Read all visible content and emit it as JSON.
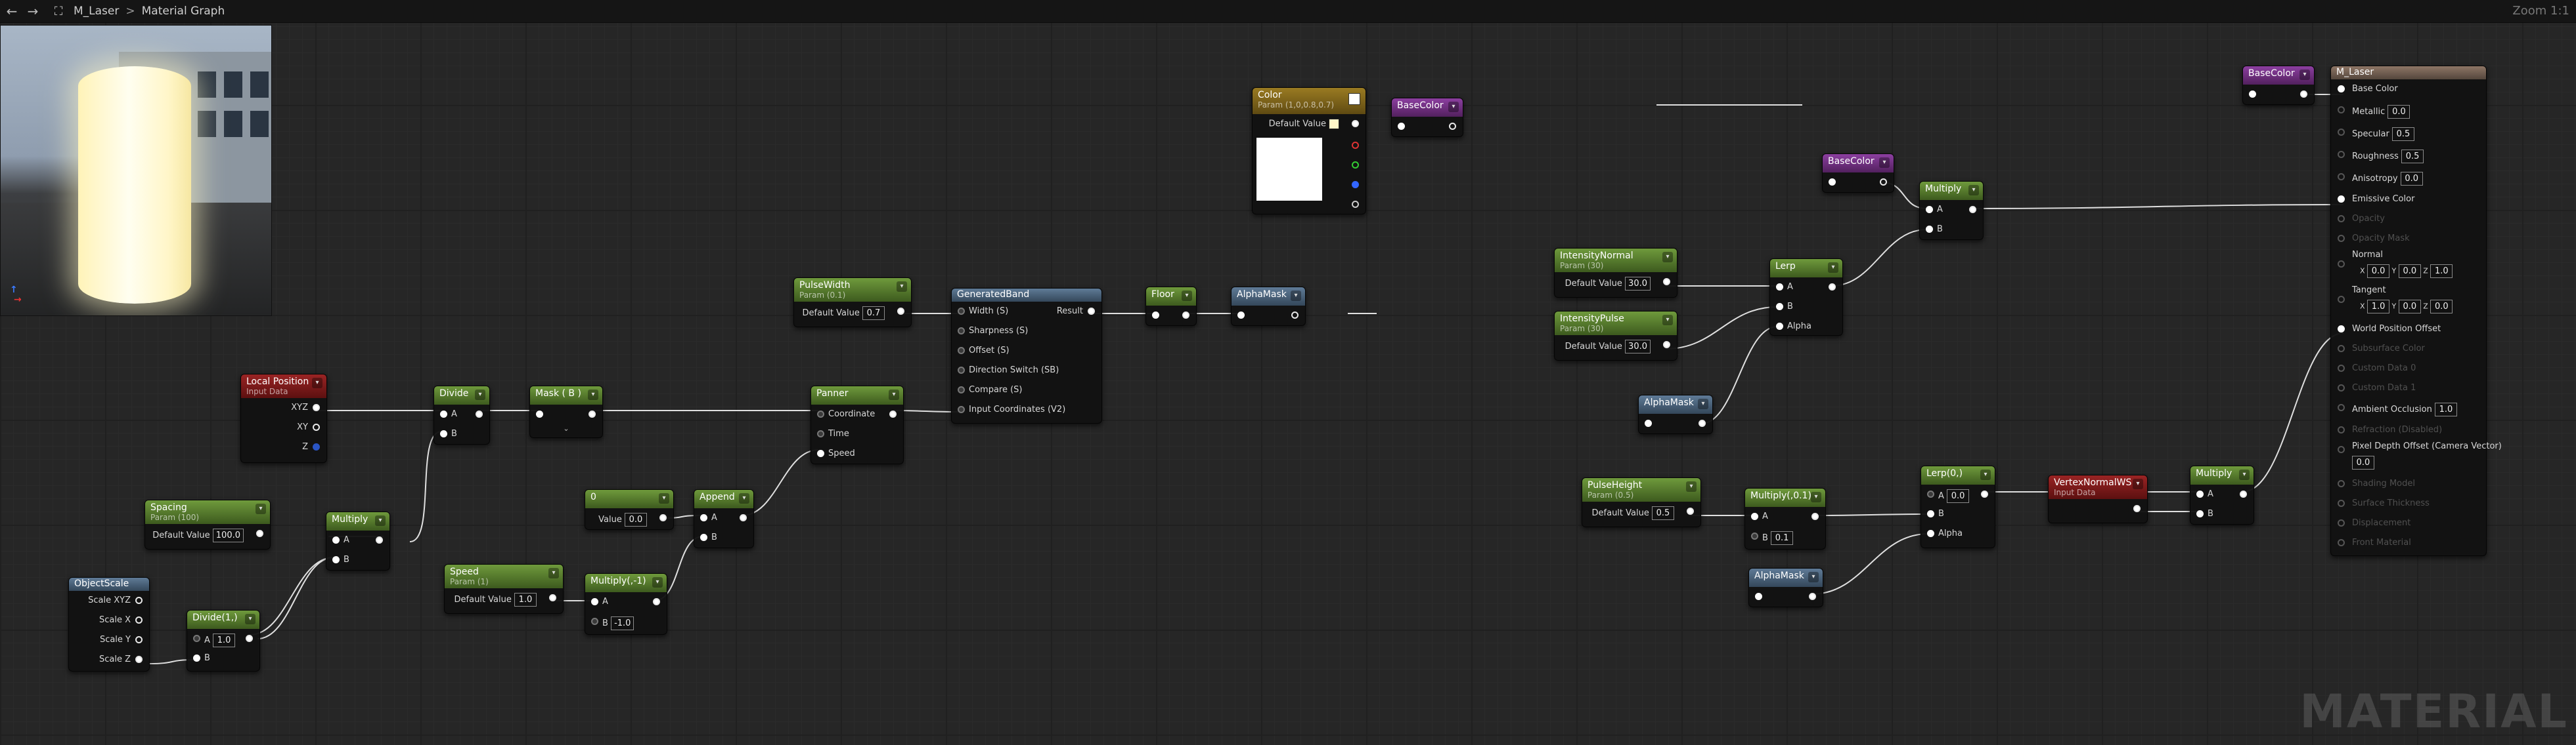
{
  "topbar": {
    "back_icon": "←",
    "forward_icon": "→",
    "graph_icon": "⛶",
    "asset": "M_Laser",
    "separator": ">",
    "title": "Material Graph",
    "zoom": "Zoom 1:1"
  },
  "watermark": "MATERIAL",
  "nodes": {
    "color": {
      "title": "Color",
      "subtitle": "Param (1,0,0.8,0.7)",
      "default_label": "Default Value"
    },
    "basecolor_1": {
      "title": "BaseColor"
    },
    "pulsewidth": {
      "title": "PulseWidth",
      "subtitle": "Param (0.1)",
      "default_label": "Default Value",
      "value": "0.7"
    },
    "generatedband": {
      "title": "GeneratedBand",
      "pins": [
        "Width (S)",
        "Sharpness (S)",
        "Offset (S)",
        "Direction Switch (SB)",
        "Compare (S)",
        "Input Coordinates (V2)"
      ],
      "result": "Result"
    },
    "floor": {
      "title": "Floor"
    },
    "alphamask_1": {
      "title": "AlphaMask"
    },
    "local_position": {
      "title": "Local Position",
      "subtitle": "Input Data",
      "pins": [
        "XYZ",
        "XY",
        "Z"
      ]
    },
    "divide": {
      "title": "Divide",
      "a": "A",
      "b": "B"
    },
    "mask": {
      "title": "Mask ( B )"
    },
    "panner": {
      "title": "Panner",
      "pins": [
        "Coordinate",
        "Time",
        "Speed"
      ]
    },
    "spacing": {
      "title": "Spacing",
      "subtitle": "Param (100)",
      "default_label": "Default Value",
      "value": "100.0"
    },
    "multiply_1": {
      "title": "Multiply",
      "a": "A",
      "b": "B"
    },
    "objectscale": {
      "title": "ObjectScale",
      "pins": [
        "Scale XYZ",
        "Scale X",
        "Scale Y",
        "Scale Z"
      ]
    },
    "divide2": {
      "title": "Divide(1,)",
      "a": "A",
      "a_value": "1.0",
      "b": "B"
    },
    "speed": {
      "title": "Speed",
      "subtitle": "Param (1)",
      "default_label": "Default Value",
      "value": "1.0"
    },
    "multiply_neg": {
      "title": "Multiply(,-1)",
      "a": "A",
      "b": "B",
      "b_value": "-1.0"
    },
    "constant": {
      "title": "0",
      "value_label": "Value",
      "value": "0.0"
    },
    "append": {
      "title": "Append",
      "a": "A",
      "b": "B"
    },
    "basecolor_2": {
      "title": "BaseColor"
    },
    "multiply_2": {
      "title": "Multiply",
      "a": "A",
      "b": "B"
    },
    "intensity_normal": {
      "title": "IntensityNormal",
      "subtitle": "Param (30)",
      "default_label": "Default Value",
      "value": "30.0"
    },
    "intensity_pulse": {
      "title": "IntensityPulse",
      "subtitle": "Param (30)",
      "default_label": "Default Value",
      "value": "30.0"
    },
    "lerp_1": {
      "title": "Lerp",
      "pins": [
        "A",
        "B",
        "Alpha"
      ]
    },
    "alphamask_2": {
      "title": "AlphaMask"
    },
    "pulseheight": {
      "title": "PulseHeight",
      "subtitle": "Param (0.5)",
      "default_label": "Default Value",
      "value": "0.5"
    },
    "multiply_01": {
      "title": "Multiply(,0.1)",
      "a": "A",
      "b": "B",
      "b_value": "0.1"
    },
    "alphamask_3": {
      "title": "AlphaMask"
    },
    "lerp_2": {
      "title": "Lerp(0,)",
      "a": "A",
      "a_value": "0.0",
      "b": "B",
      "alpha": "Alpha"
    },
    "vertexnormal": {
      "title": "VertexNormalWS",
      "subtitle": "Input Data"
    },
    "multiply_3": {
      "title": "Multiply",
      "a": "A",
      "b": "B"
    },
    "basecolor_3": {
      "title": "BaseColor"
    },
    "result": {
      "title": "M_Laser",
      "base_color": "Base Color",
      "metallic": "Metallic",
      "metallic_value": "0.0",
      "specular": "Specular",
      "specular_value": "0.5",
      "roughness": "Roughness",
      "roughness_value": "0.5",
      "anisotropy": "Anisotropy",
      "anisotropy_value": "0.0",
      "emissive": "Emissive Color",
      "opacity": "Opacity",
      "opacity_mask": "Opacity Mask",
      "normal": "Normal",
      "normal_values": [
        "X",
        "0.0",
        "Y",
        "0.0",
        "Z",
        "1.0"
      ],
      "tangent": "Tangent",
      "tangent_values": [
        "X",
        "1.0",
        "Y",
        "0.0",
        "Z",
        "0.0"
      ],
      "wpo": "World Position Offset",
      "subsurface": "Subsurface Color",
      "custom0": "Custom Data 0",
      "custom1": "Custom Data 1",
      "ao": "Ambient Occlusion",
      "ao_value": "1.0",
      "refraction": "Refraction (Disabled)",
      "pdo": "Pixel Depth Offset (Camera Vector)",
      "pdo_value": "0.0",
      "shading_model": "Shading Model",
      "surface_thickness": "Surface Thickness",
      "displacement": "Displacement",
      "front_material": "Front Material"
    }
  },
  "colors": {
    "param_green": "#5b8a2e",
    "input_red": "#8a1f1f",
    "function_blue": "#4f6a85",
    "vector_param_gold": "#8a6d1c",
    "reroute_purple": "#7a3590",
    "color_swatch": "#fff6c8",
    "wire": "#e0e0e0"
  }
}
